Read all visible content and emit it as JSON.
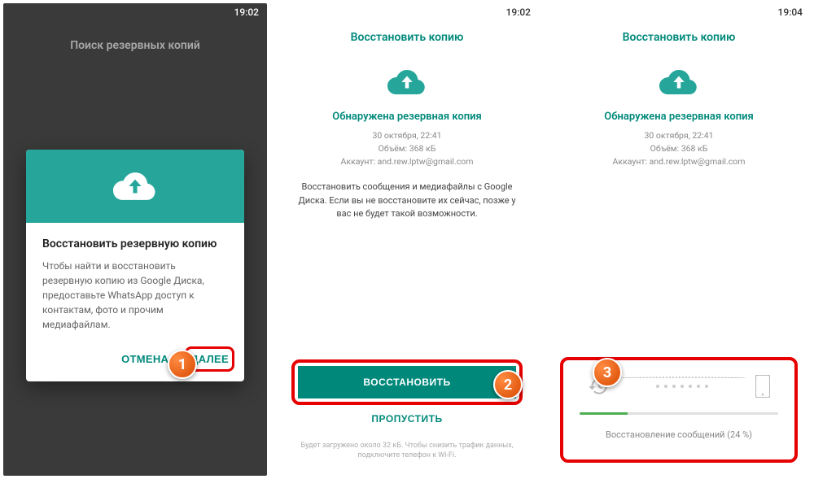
{
  "phone1": {
    "time": "19:02",
    "title": "Поиск резервных копий",
    "dialog": {
      "title": "Восстановить резервную копию",
      "text": "Чтобы найти и восстановить резервную копию из Google Диска, предоставьте WhatsApp доступ к контактам, фото и прочим медиафайлам.",
      "cancel": "ОТМЕНА",
      "next": "ДАЛЕЕ"
    }
  },
  "phone2": {
    "time": "19:02",
    "title": "Восстановить копию",
    "found": "Обнаружена резервная копия",
    "date": "30 октября, 22:41",
    "size": "Объём: 368 кБ",
    "account": "Аккаунт: and.rew.lptw@gmail.com",
    "msg": "Восстановить сообщения и медиафайлы с Google Диска. Если вы не восстановите их сейчас, позже у вас не будет такой возможности.",
    "restore": "ВОССТАНОВИТЬ",
    "skip": "ПРОПУСТИТЬ",
    "footer": "Будет загружено около 32 кБ. Чтобы снизить трафик данных, подключите телефон к Wi-Fi."
  },
  "phone3": {
    "time": "19:04",
    "title": "Восстановить копию",
    "found": "Обнаружена резервная копия",
    "date": "30 октября, 22:41",
    "size": "Объём: 368 кБ",
    "account": "Аккаунт: and.rew.lptw@gmail.com",
    "progress_text": "Восстановление сообщений (24 %)",
    "progress_pct": 24
  },
  "badges": {
    "b1": "1",
    "b2": "2",
    "b3": "3"
  }
}
